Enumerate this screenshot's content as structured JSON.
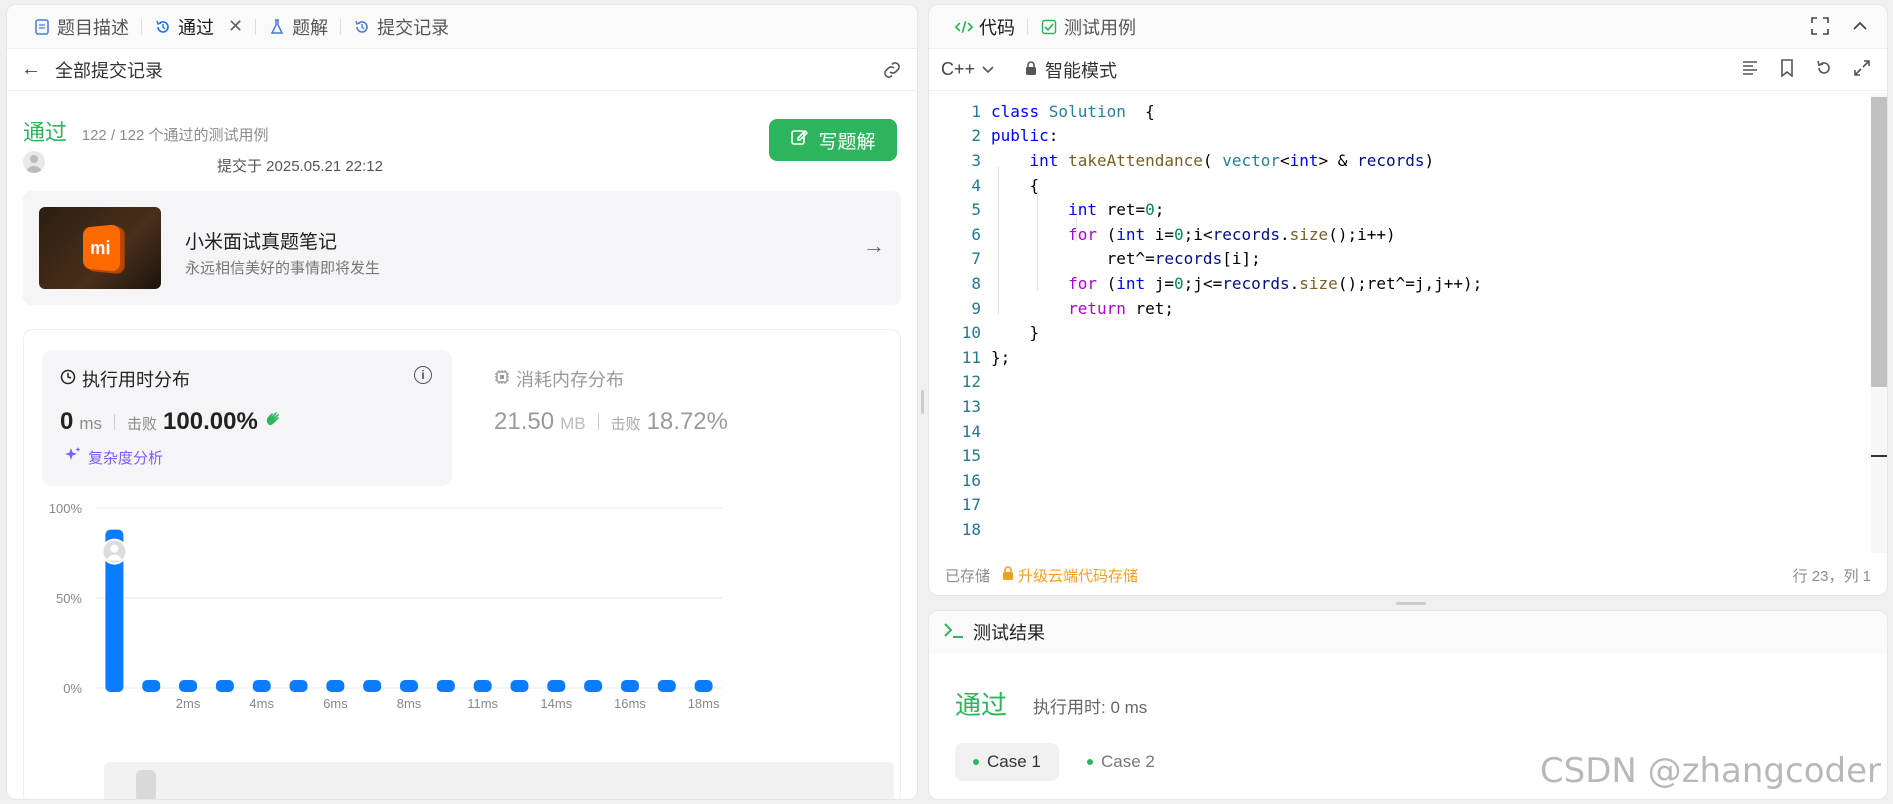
{
  "left_tabs": [
    {
      "label": "题目描述",
      "icon": "doc-icon"
    },
    {
      "label": "通过",
      "icon": "history-icon"
    },
    {
      "label": "题解",
      "icon": "flask-icon"
    },
    {
      "label": "提交记录",
      "icon": "history-icon"
    }
  ],
  "subbar": {
    "back_label": "全部提交记录"
  },
  "submission": {
    "status": "通过",
    "passed_text": "122 / 122 个通过的测试用例",
    "submitted_at": "提交于 2025.05.21 22:12",
    "write_solution": "写题解"
  },
  "promo": {
    "title": "小米面试真题笔记",
    "subtitle": "永远相信美好的事情即将发生",
    "logo_text": "mi"
  },
  "runtime": {
    "label": "执行用时分布",
    "value": "0",
    "unit": "ms",
    "beat_label": "击败",
    "beat_value": "100.00%",
    "complexity": "复杂度分析"
  },
  "memory": {
    "label": "消耗内存分布",
    "value": "21.50",
    "unit": "MB",
    "beat_label": "击败",
    "beat_value": "18.72%"
  },
  "chart_data": {
    "type": "bar",
    "categories": [
      "0ms",
      "1ms",
      "2ms",
      "3ms",
      "4ms",
      "5ms",
      "6ms",
      "7ms",
      "8ms",
      "9ms",
      "11ms",
      "12ms",
      "14ms",
      "15ms",
      "16ms",
      "17ms",
      "18ms"
    ],
    "x_tick_labels": [
      "2ms",
      "4ms",
      "6ms",
      "8ms",
      "11ms",
      "14ms",
      "16ms",
      "18ms"
    ],
    "values": [
      88,
      1,
      1,
      1,
      1,
      1,
      1,
      1,
      1,
      1,
      1,
      1,
      1,
      1,
      1,
      1,
      1
    ],
    "y_tick_labels": [
      "100%",
      "50%",
      "0%"
    ],
    "ylim": [
      0,
      100
    ],
    "grid": true,
    "bar_color": "#0a7cff",
    "highlight_index": 0
  },
  "code_tabs": [
    {
      "label": "代码",
      "icon": "code-icon"
    },
    {
      "label": "测试用例",
      "icon": "check-square-icon"
    }
  ],
  "editor": {
    "language": "C++",
    "mode": "智能模式",
    "lines": [
      {
        "n": "1",
        "tokens": [
          [
            "kw",
            "class "
          ],
          [
            "ty",
            "Solution"
          ],
          [
            "",
            "  {"
          ]
        ]
      },
      {
        "n": "2",
        "tokens": [
          [
            "kw",
            "public"
          ],
          [
            "",
            ":"
          ]
        ]
      },
      {
        "n": "3",
        "tokens": [
          [
            "",
            "    "
          ],
          [
            "kw",
            "int "
          ],
          [
            "fn",
            "takeAttendance"
          ],
          [
            "",
            "( "
          ],
          [
            "ty",
            "vector"
          ],
          [
            "",
            "<"
          ],
          [
            "kw",
            "int"
          ],
          [
            "",
            "> & "
          ],
          [
            "var",
            "records"
          ],
          [
            "",
            ")"
          ]
        ]
      },
      {
        "n": "4",
        "tokens": [
          [
            "",
            "    {"
          ]
        ]
      },
      {
        "n": "5",
        "tokens": [
          [
            "",
            "        "
          ],
          [
            "kw",
            "int "
          ],
          [
            "",
            "ret="
          ],
          [
            "num",
            "0"
          ],
          [
            "",
            ";"
          ]
        ]
      },
      {
        "n": "6",
        "tokens": [
          [
            "",
            "        "
          ],
          [
            "ctl",
            "for "
          ],
          [
            "",
            "("
          ],
          [
            "kw",
            "int "
          ],
          [
            "",
            "i="
          ],
          [
            "num",
            "0"
          ],
          [
            "",
            ";i<"
          ],
          [
            "var",
            "records"
          ],
          [
            "",
            "."
          ],
          [
            "fn",
            "size"
          ],
          [
            "",
            "();i++)"
          ]
        ]
      },
      {
        "n": "7",
        "tokens": [
          [
            "",
            "            ret^="
          ],
          [
            "var",
            "records"
          ],
          [
            "",
            "[i];"
          ]
        ]
      },
      {
        "n": "8",
        "tokens": [
          [
            "",
            "        "
          ],
          [
            "ctl",
            "for "
          ],
          [
            "",
            "("
          ],
          [
            "kw",
            "int "
          ],
          [
            "",
            "j="
          ],
          [
            "num",
            "0"
          ],
          [
            "",
            ";j<="
          ],
          [
            "var",
            "records"
          ],
          [
            "",
            "."
          ],
          [
            "fn",
            "size"
          ],
          [
            "",
            "();ret^=j,j++);"
          ]
        ]
      },
      {
        "n": "9",
        "tokens": [
          [
            "",
            "        "
          ],
          [
            "ctl",
            "return "
          ],
          [
            "",
            "ret;"
          ]
        ]
      },
      {
        "n": "10",
        "tokens": [
          [
            "",
            "    }"
          ]
        ]
      },
      {
        "n": "11",
        "tokens": [
          [
            "",
            "};"
          ]
        ]
      },
      {
        "n": "12",
        "tokens": []
      },
      {
        "n": "13",
        "tokens": []
      },
      {
        "n": "14",
        "tokens": []
      },
      {
        "n": "15",
        "tokens": []
      },
      {
        "n": "16",
        "tokens": []
      },
      {
        "n": "17",
        "tokens": []
      },
      {
        "n": "18",
        "tokens": []
      }
    ],
    "saved": "已存储",
    "upgrade": "升级云端代码存储",
    "cursor": "行 23，列 1"
  },
  "result": {
    "header": "测试结果",
    "status": "通过",
    "time": "执行用时: 0 ms",
    "cases": [
      "Case 1",
      "Case 2"
    ]
  },
  "watermark": "CSDN @zhangcoder"
}
